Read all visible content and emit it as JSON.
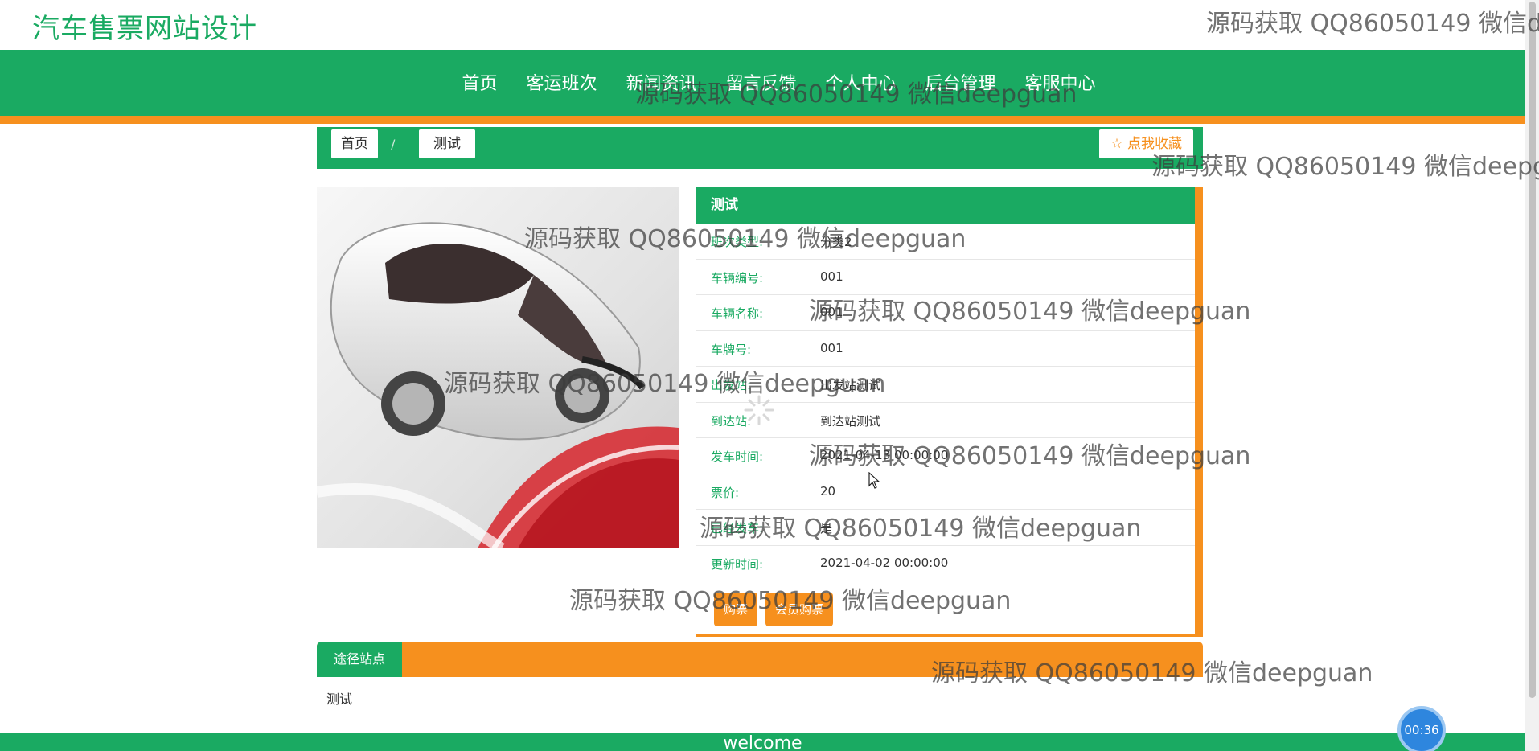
{
  "site": {
    "title": "汽车售票网站设计"
  },
  "nav": {
    "items": [
      "首页",
      "客运班次",
      "新闻资讯",
      "留言反馈",
      "个人中心",
      "后台管理",
      "客服中心"
    ]
  },
  "breadcrumb": {
    "home": "首页",
    "separator": "/",
    "current": "测试"
  },
  "favorite_button": "☆ 点我收藏",
  "detail": {
    "title": "测试",
    "rows": [
      {
        "label": "班次类型:",
        "value": "分类2"
      },
      {
        "label": "车辆编号:",
        "value": "001"
      },
      {
        "label": "车辆名称:",
        "value": "001"
      },
      {
        "label": "车牌号:",
        "value": "001"
      },
      {
        "label": "出发站:",
        "value": "出发站测试"
      },
      {
        "label": "到达站:",
        "value": "到达站测试"
      },
      {
        "label": "发车时间:",
        "value": "2021-04-13 00:00:00"
      },
      {
        "label": "票价:",
        "value": "20"
      },
      {
        "label": "已经发车:",
        "value": "是"
      },
      {
        "label": "更新时间:",
        "value": "2021-04-02 00:00:00"
      }
    ],
    "buttons": {
      "buy": "购票",
      "member_buy": "会员购票"
    }
  },
  "route": {
    "tab": "途径站点",
    "content": "测试"
  },
  "footer": {
    "text": "welcome"
  },
  "timer": "00:36",
  "watermark": "源码获取 QQ86050149 微信deepguan",
  "colors": {
    "primary": "#1aaa62",
    "accent": "#f6901e"
  }
}
